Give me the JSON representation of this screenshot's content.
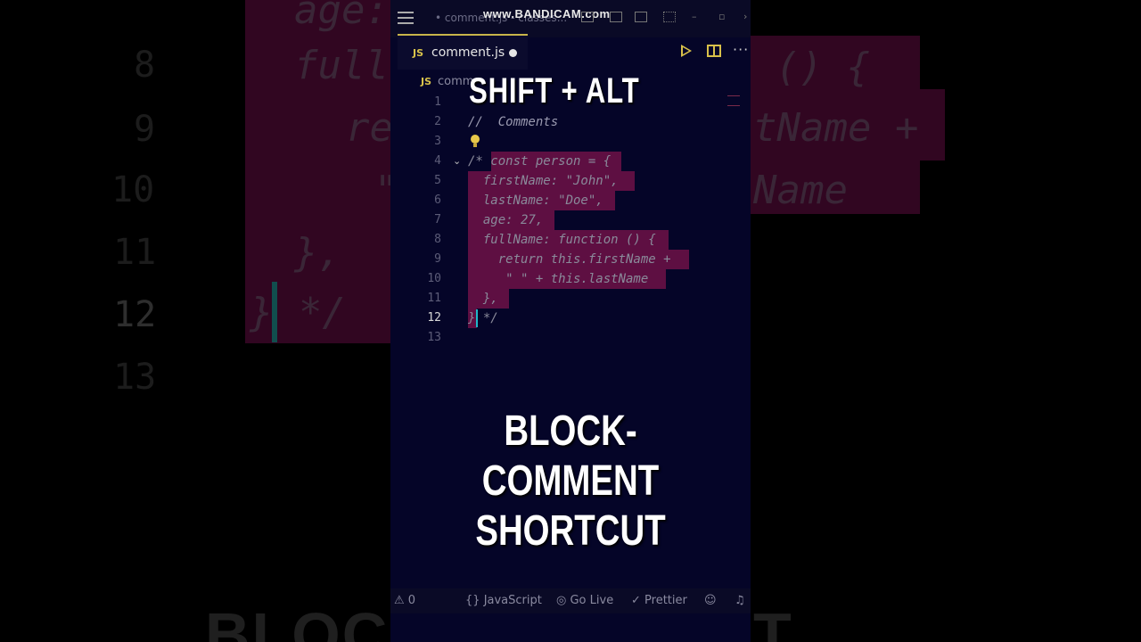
{
  "background": {
    "line_numbers": [
      "8",
      "9",
      "10",
      "11",
      "12",
      "13"
    ],
    "code_fragments": [
      "age:",
      "full",
      "re",
      "\"",
      "},",
      "}",
      "*/",
      "() {",
      "tName +",
      "Name"
    ],
    "caption": "BLOCK-COMMENT"
  },
  "watermark": "www.BANDICAM.com",
  "window": {
    "title": "• comment.js - classes..."
  },
  "tab": {
    "icon_label": "JS",
    "filename": "comment.js"
  },
  "breadcrumb": {
    "icon_label": "JS",
    "text": "comm"
  },
  "overlay": {
    "top": "SHIFT + ALT",
    "middle_line1": "BLOCK-COMMENT",
    "middle_line2": "SHORTCUT"
  },
  "editor": {
    "lines": [
      {
        "n": "1",
        "text": ""
      },
      {
        "n": "2",
        "text": "//  Comments"
      },
      {
        "n": "3",
        "text": ""
      },
      {
        "n": "4",
        "text": "/* const person = {"
      },
      {
        "n": "5",
        "text": "  firstName: \"John\","
      },
      {
        "n": "6",
        "text": "  lastName: \"Doe\","
      },
      {
        "n": "7",
        "text": "  age: 27,"
      },
      {
        "n": "8",
        "text": "  fullName: function () {"
      },
      {
        "n": "9",
        "text": "    return this.firstName +"
      },
      {
        "n": "10",
        "text": "     \" \" + this.lastName"
      },
      {
        "n": "11",
        "text": "  },"
      },
      {
        "n": "12",
        "text": "} */"
      },
      {
        "n": "13",
        "text": ""
      }
    ],
    "active_line": "12"
  },
  "statusbar": {
    "problems": "0",
    "language": "JavaScript",
    "go_live": "Go Live",
    "prettier": "Prettier"
  },
  "colors": {
    "editor_bg": "#050528",
    "selection": "#5e0f42",
    "accent": "#d8c04a",
    "cursor": "#1fb8c8"
  }
}
